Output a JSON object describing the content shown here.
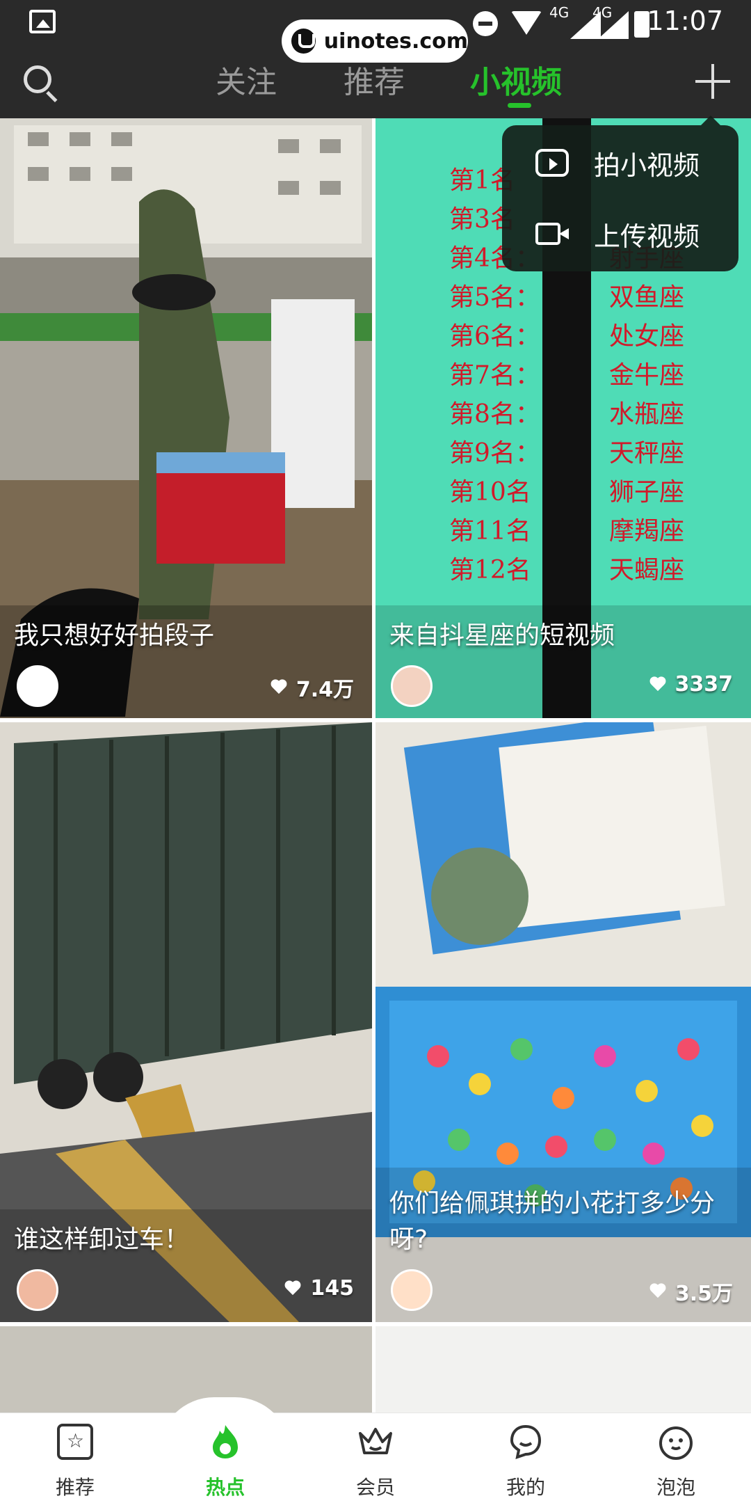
{
  "watermark": "uinotes.com",
  "status": {
    "time": "11:07",
    "network_1": "4G",
    "network_2": "4G"
  },
  "header": {
    "tabs": [
      {
        "label": "关注"
      },
      {
        "label": "推荐"
      },
      {
        "label": "小视频"
      }
    ],
    "active_tab": "小视频",
    "accent_color": "#26c22b"
  },
  "popup": {
    "items": [
      {
        "label": "拍小视频",
        "icon": "video-play-icon"
      },
      {
        "label": "上传视频",
        "icon": "video-camera-icon"
      }
    ]
  },
  "feed": {
    "cards": [
      {
        "title": "我只想好好拍段子",
        "likes": "7.4万"
      },
      {
        "title": "来自抖星座的短视频",
        "likes": "3337",
        "overlay_text": [
          "第1名",
          "第3名",
          "第4名：",
          "射手座",
          "第5名：",
          "双鱼座",
          "第6名：",
          "处女座",
          "第7名：",
          "金牛座",
          "第8名：",
          "水瓶座",
          "第9名：",
          "天秤座",
          "第10名",
          "狮子座",
          "第11名",
          "摩羯座",
          "第12名",
          "天蝎座"
        ]
      },
      {
        "title": "谁这样卸过车！",
        "likes": "145"
      },
      {
        "title": "你们给佩琪拼的小花打多少分呀?",
        "likes": "3.5万"
      }
    ]
  },
  "bottom_nav": {
    "items": [
      {
        "label": "推荐",
        "icon": "star-icon"
      },
      {
        "label": "热点",
        "icon": "flame-icon"
      },
      {
        "label": "会员",
        "icon": "crown-icon"
      },
      {
        "label": "我的",
        "icon": "profile-icon"
      },
      {
        "label": "泡泡",
        "icon": "bubble-face-icon"
      }
    ],
    "active": "热点"
  }
}
